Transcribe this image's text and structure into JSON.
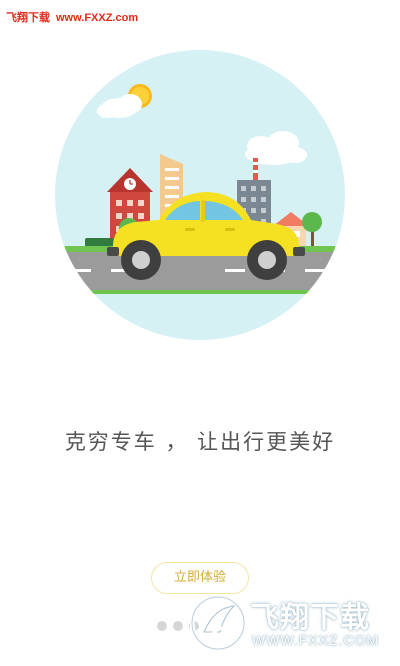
{
  "watermark": {
    "top_brand": "飞翔下载",
    "top_site": "www.FXXZ.com",
    "logo_text": "飞翔下载",
    "logo_url": "WWW.FXXZ.COM"
  },
  "onboarding": {
    "slogan": "克穷专车 ， 让出行更美好",
    "cta_label": "立即体验",
    "page_indicator": {
      "count": 3,
      "active_index": 0
    }
  },
  "colors": {
    "background": "#ffffff",
    "hero_circle": "#d5f1f3",
    "car": "#f5e021",
    "cta_border": "#f3e4a3",
    "cta_text": "#d3ac30",
    "slogan_text": "#555555",
    "watermark_red": "#e22a1b"
  },
  "icons": {
    "hero": "taxi-car-city-illustration",
    "watermark_logo": "fxxz-logo-icon"
  }
}
